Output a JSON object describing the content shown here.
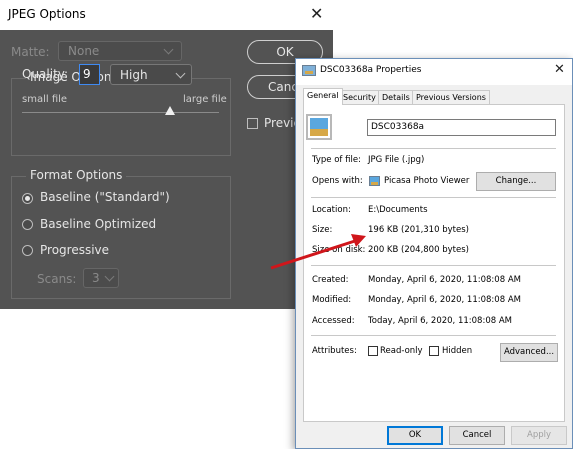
{
  "jpeg_dialog": {
    "title": "JPEG Options",
    "close_glyph": "✕",
    "matte": {
      "label": "Matte:",
      "value": "None"
    },
    "image_options": {
      "title": "Image Options",
      "quality_label": "Quality:",
      "quality_value": "9",
      "quality_preset": "High",
      "small_file_label": "small file",
      "large_file_label": "large file",
      "slider_value": 9,
      "slider_max": 12
    },
    "format_options": {
      "title": "Format Options",
      "radios": [
        {
          "label": "Baseline (\"Standard\")",
          "selected": true
        },
        {
          "label": "Baseline Optimized",
          "selected": false
        },
        {
          "label": "Progressive",
          "selected": false
        }
      ],
      "scans_label": "Scans:",
      "scans_value": "3"
    },
    "ok_label": "OK",
    "cancel_label": "Canc",
    "preview_label": "Previe"
  },
  "properties_dialog": {
    "title": "DSC03368a Properties",
    "close_glyph": "✕",
    "tabs": [
      {
        "label": "General",
        "active": true
      },
      {
        "label": "Security",
        "active": false
      },
      {
        "label": "Details",
        "active": false
      },
      {
        "label": "Previous Versions",
        "active": false
      }
    ],
    "file_name": "DSC03368a",
    "rows": {
      "type_of_file": {
        "label": "Type of file:",
        "value": "JPG File (.jpg)"
      },
      "opens_with": {
        "label": "Opens with:",
        "value": "Picasa Photo Viewer",
        "button": "Change..."
      },
      "location": {
        "label": "Location:",
        "value": "E:\\Documents"
      },
      "size": {
        "label": "Size:",
        "value": "196 KB (201,310 bytes)"
      },
      "size_on_disk": {
        "label": "Size on disk:",
        "value": "200 KB (204,800 bytes)"
      },
      "created": {
        "label": "Created:",
        "value": "Monday, April 6, 2020, 11:08:08 AM"
      },
      "modified": {
        "label": "Modified:",
        "value": "Monday, April 6, 2020, 11:08:08 AM"
      },
      "accessed": {
        "label": "Accessed:",
        "value": "Today, April 6, 2020, 11:08:08 AM"
      }
    },
    "attributes": {
      "label": "Attributes:",
      "read_only_label": "Read-only",
      "hidden_label": "Hidden",
      "advanced_button": "Advanced..."
    },
    "buttons": {
      "ok": "OK",
      "cancel": "Cancel",
      "apply": "Apply"
    }
  },
  "annotation": {
    "arrow_color": "#d0161b"
  }
}
